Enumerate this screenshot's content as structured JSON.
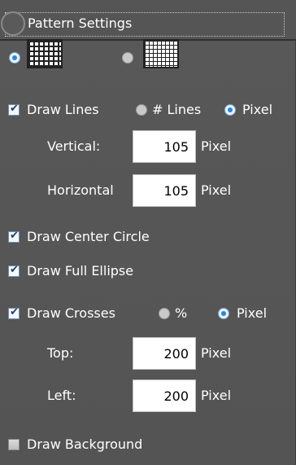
{
  "panel": {
    "title": "Pattern Settings"
  },
  "pattern": {
    "options": [
      {
        "selected": true,
        "icon": "grid-coarse-icon"
      },
      {
        "selected": false,
        "icon": "grid-fine-icon"
      }
    ]
  },
  "lines": {
    "draw_label": "Draw Lines",
    "checked": true,
    "mode_lines_label": "# Lines",
    "mode_pixel_label": "Pixel",
    "mode_selected": "Pixel",
    "vertical_label": "Vertical:",
    "vertical_value": "105",
    "vertical_unit": "Pixel",
    "horizontal_label": "Horizontal",
    "horizontal_value": "105",
    "horizontal_unit": "Pixel"
  },
  "center_circle": {
    "label": "Draw Center Circle",
    "checked": true
  },
  "full_ellipse": {
    "label": "Draw Full Ellipse",
    "checked": true
  },
  "crosses": {
    "draw_label": "Draw Crosses",
    "checked": true,
    "mode_percent_label": "%",
    "mode_pixel_label": "Pixel",
    "mode_selected": "Pixel",
    "top_label": "Top:",
    "top_value": "200",
    "top_unit": "Pixel",
    "left_label": "Left:",
    "left_value": "200",
    "left_unit": "Pixel"
  },
  "background": {
    "label": "Draw Background",
    "checked": false
  },
  "colors": {
    "accent": "#2a86d6",
    "panel": "#555555"
  }
}
